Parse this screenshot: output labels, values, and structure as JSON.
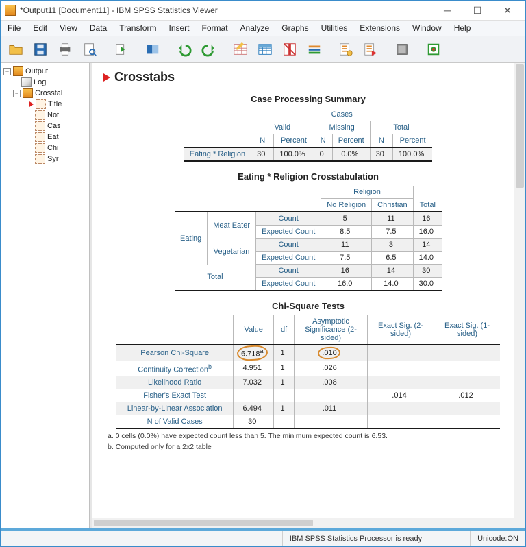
{
  "window": {
    "title": "*Output11 [Document11] - IBM SPSS Statistics Viewer"
  },
  "menu": [
    "File",
    "Edit",
    "View",
    "Data",
    "Transform",
    "Insert",
    "Format",
    "Analyze",
    "Graphs",
    "Utilities",
    "Extensions",
    "Window",
    "Help"
  ],
  "toolbar_icons": [
    "open",
    "save",
    "print",
    "print-preview",
    "export",
    "recall-dialog",
    "undo",
    "redo",
    "goto-data",
    "goto-case",
    "variables",
    "run",
    "select",
    "show-hide",
    "script",
    "designate-window",
    "add"
  ],
  "tree": {
    "root": "Output",
    "items": [
      "Log",
      "Crosstabs"
    ],
    "crosstabs_children": [
      "Title",
      "Notes",
      "Case Processing Summary",
      "Eating * Religion Crosstabulation",
      "Chi-Square Tests",
      "Symmetric Measures"
    ],
    "crosstabs_children_short": [
      "Title",
      "Not",
      "Cas",
      "Eat",
      "Chi",
      "Syr"
    ]
  },
  "main": {
    "heading": "Crosstabs",
    "case_summary": {
      "title": "Case Processing Summary",
      "super": "Cases",
      "groups": [
        "Valid",
        "Missing",
        "Total"
      ],
      "cols": [
        "N",
        "Percent",
        "N",
        "Percent",
        "N",
        "Percent"
      ],
      "row_label": "Eating * Religion",
      "row": [
        "30",
        "100.0%",
        "0",
        "0.0%",
        "30",
        "100.0%"
      ]
    },
    "crosstab": {
      "title": "Eating * Religion Crosstabulation",
      "col_super": "Religion",
      "cols": [
        "No Religion",
        "Christian",
        "Total"
      ],
      "row_super": "Eating",
      "groups": [
        {
          "label": "Meat Eater",
          "count": [
            "5",
            "11",
            "16"
          ],
          "expected": [
            "8.5",
            "7.5",
            "16.0"
          ]
        },
        {
          "label": "Vegetarian",
          "count": [
            "11",
            "3",
            "14"
          ],
          "expected": [
            "7.5",
            "6.5",
            "14.0"
          ]
        }
      ],
      "total": {
        "label": "Total",
        "count": [
          "16",
          "14",
          "30"
        ],
        "expected": [
          "16.0",
          "14.0",
          "30.0"
        ]
      },
      "stat1": "Count",
      "stat2": "Expected Count"
    },
    "chisq": {
      "title": "Chi-Square Tests",
      "cols": [
        "Value",
        "df",
        "Asymptotic Significance (2-sided)",
        "Exact Sig. (2-sided)",
        "Exact Sig. (1-sided)"
      ],
      "rows": [
        {
          "label": "Pearson Chi-Square",
          "value": "6.718",
          "sup": "a",
          "df": "1",
          "asig": ".010",
          "ex2": "",
          "ex1": ""
        },
        {
          "label": "Continuity Correction",
          "sup_label": "b",
          "value": "4.951",
          "df": "1",
          "asig": ".026",
          "ex2": "",
          "ex1": ""
        },
        {
          "label": "Likelihood Ratio",
          "value": "7.032",
          "df": "1",
          "asig": ".008",
          "ex2": "",
          "ex1": ""
        },
        {
          "label": "Fisher's Exact Test",
          "value": "",
          "df": "",
          "asig": "",
          "ex2": ".014",
          "ex1": ".012"
        },
        {
          "label": "Linear-by-Linear Association",
          "value": "6.494",
          "df": "1",
          "asig": ".011",
          "ex2": "",
          "ex1": ""
        },
        {
          "label": "N of Valid Cases",
          "value": "30",
          "df": "",
          "asig": "",
          "ex2": "",
          "ex1": ""
        }
      ],
      "foot_a": "a. 0 cells (0.0%) have expected count less than 5. The minimum expected count is 6.53.",
      "foot_b": "b. Computed only for a 2x2 table"
    }
  },
  "status": {
    "processor": "IBM SPSS Statistics Processor is ready",
    "unicode": "Unicode:ON"
  }
}
